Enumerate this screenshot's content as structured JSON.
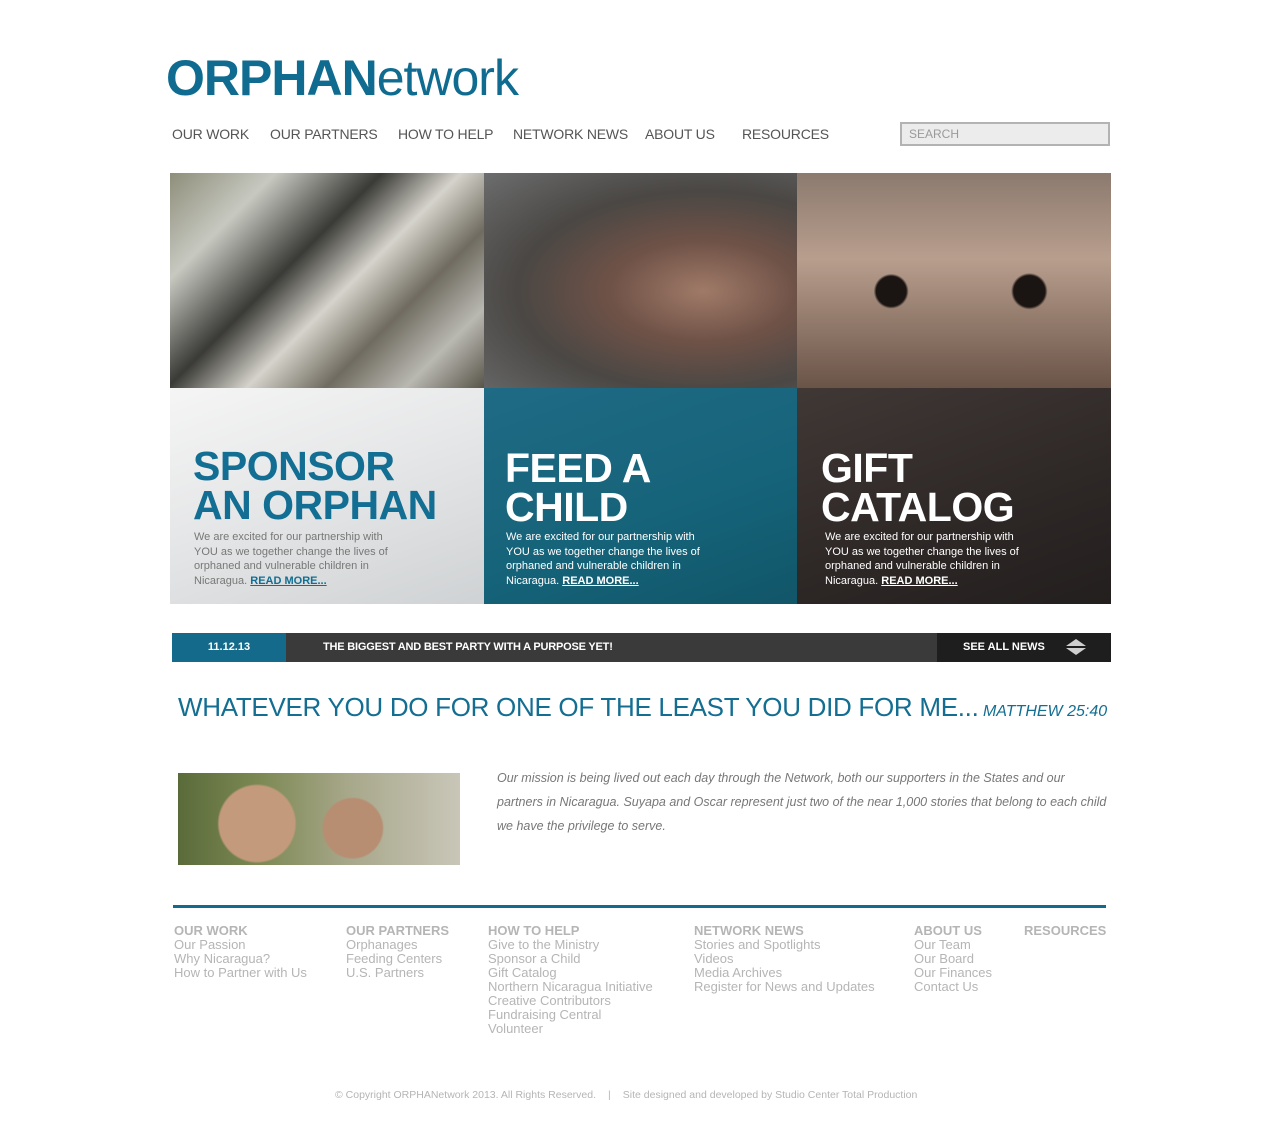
{
  "logo": {
    "bold": "ORPHAN",
    "light": "etwork"
  },
  "nav": [
    "OUR WORK",
    "OUR PARTNERS",
    "HOW TO HELP",
    "NETWORK NEWS",
    "ABOUT US",
    "RESOURCES"
  ],
  "search": {
    "placeholder": "SEARCH"
  },
  "hero": [
    {
      "title_line1": "SPONSOR",
      "title_line2": "AN ORPHAN",
      "text": "We are excited for our partnership with YOU as we together change the lives of orphaned and vulnerable children in Nicaragua.",
      "more": "READ MORE..."
    },
    {
      "title_line1": "FEED A",
      "title_line2": "CHILD",
      "text": "We are excited for our partnership with YOU as we together change the lives of orphaned and vulnerable children in Nicaragua.",
      "more": "READ MORE..."
    },
    {
      "title_line1": "GIFT",
      "title_line2": "CATALOG",
      "text": "We are excited for our partnership with YOU as we together change the lives of orphaned and vulnerable children in Nicaragua.",
      "more": "READ MORE..."
    }
  ],
  "news": {
    "date": "11.12.13",
    "title": "THE BIGGEST AND BEST PARTY WITH A PURPOSE YET!",
    "see_all": "SEE ALL NEWS"
  },
  "quote": {
    "text": "WHATEVER YOU DO FOR ONE OF THE LEAST YOU DID FOR ME...",
    "ref": "MATTHEW 25:40"
  },
  "mission": {
    "text": "Our mission is being lived out each day through the Network, both our supporters in the States and our partners in Nicaragua.  Suyapa and Oscar represent just two of the near 1,000 stories that belong to each child we have the privilege to serve."
  },
  "footer": {
    "columns": [
      {
        "heading": "OUR WORK",
        "links": [
          "Our Passion",
          "Why Nicaragua?",
          "How to Partner with Us"
        ]
      },
      {
        "heading": "OUR PARTNERS",
        "links": [
          "Orphanages",
          "Feeding Centers",
          "U.S. Partners"
        ]
      },
      {
        "heading": "HOW TO HELP",
        "links": [
          "Give to the Ministry",
          "Sponsor a Child",
          "Gift Catalog",
          "Northern Nicaragua Initiative",
          "Creative Contributors",
          "Fundraising Central",
          "Volunteer"
        ]
      },
      {
        "heading": "NETWORK NEWS",
        "links": [
          "Stories and Spotlights",
          "Videos",
          "Media Archives",
          "Register for News and Updates"
        ]
      },
      {
        "heading": "ABOUT US",
        "links": [
          "Our Team",
          "Our Board",
          "Our Finances",
          "Contact Us"
        ]
      },
      {
        "heading": "RESOURCES",
        "links": []
      }
    ],
    "copyright": "© Copyright ORPHANetwork 2013. All Rights Reserved.",
    "separator": "|",
    "credit": "Site designed and developed by Studio Center Total Production"
  },
  "colors": {
    "brand": "#136a8a",
    "dark": "#3a3a3a",
    "footer_text": "#b5b5b5"
  },
  "icons": {
    "news_arrows": "up-down-arrows-icon"
  }
}
